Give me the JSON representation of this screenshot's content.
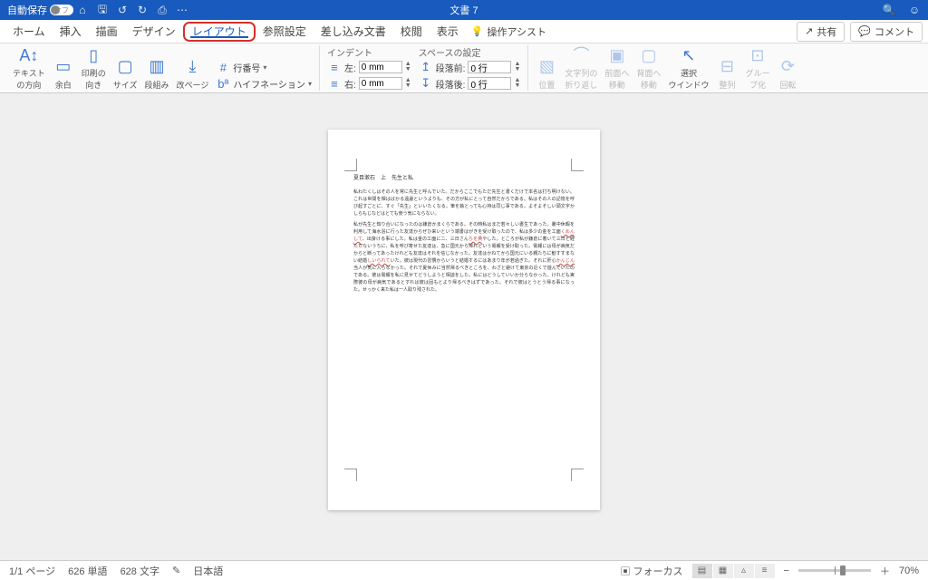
{
  "titlebar": {
    "autosave_label": "自動保存",
    "autosave_state": "オフ",
    "doc_title": "文書 7"
  },
  "tabs": {
    "items": [
      {
        "label": "ホーム",
        "active": false
      },
      {
        "label": "挿入",
        "active": false
      },
      {
        "label": "描画",
        "active": false
      },
      {
        "label": "デザイン",
        "active": false
      },
      {
        "label": "レイアウト",
        "active": true,
        "highlight": true
      },
      {
        "label": "参照設定",
        "active": false
      },
      {
        "label": "差し込み文書",
        "active": false
      },
      {
        "label": "校閲",
        "active": false
      },
      {
        "label": "表示",
        "active": false
      }
    ],
    "tell_me": "操作アシスト",
    "share": "共有",
    "comment": "コメント"
  },
  "ribbon": {
    "page_setup": {
      "text_dir": "テキスト\nの方向",
      "margins": "余白",
      "orientation": "印刷の\n向き",
      "size": "サイズ",
      "columns": "段組み",
      "breaks": "改ページ",
      "line_numbers": "行番号",
      "hyphenation": "ハイフネーション"
    },
    "indent": {
      "header": "インデント",
      "left_label": "左:",
      "left_value": "0 mm",
      "right_label": "右:",
      "right_value": "0 mm"
    },
    "spacing": {
      "header": "スペースの設定",
      "before_label": "段落前:",
      "before_value": "0 行",
      "after_label": "段落後:",
      "after_value": "0 行"
    },
    "arrange": {
      "position": "位置",
      "wrap": "文字列の\n折り返し",
      "forward": "前面へ\n移動",
      "backward": "背面へ\n移動",
      "selection": "選択\nウインドウ",
      "align": "整列",
      "group": "グルー\nプ化",
      "rotate": "回転"
    }
  },
  "document": {
    "heading": "夏目漱石　上　先生と私",
    "p1": "私わたくしはその人を常に先生と呼んでいた。だからここでもただ先生と書くだけで本名は打ち明けない。これは世間を憚はばかる遠慮というよりも、その方が私にとって自然だからである。私はその人の記憶を呼び起すごとに、すぐ「先生」といいたくなる。筆を執とっても心持は同じ事である。よそよそしい頭文字かしらもじなどはとても使う気にならない。",
    "p2_a": "私が先生と知り合いになったのは鎌倉かまくらである。その時私はまだ若々しい書生であった。暑中休暇を利用して海水浴に行った友達からぜひ来いという端書はがきを受け取ったので、私は多少の金を工面",
    "p2_r1": "くめんして",
    "p2_b": "、出掛ける事にした。私は金の工面に二、三日さん",
    "p2_r2": "ちを費",
    "p2_c": "やした。ところが私が鎌倉に着いて三日と経たたないうちに、私を呼び寄せた友達は、急に国元から帰れという電報を受け取った。電報には母が病気だからと断ってあったけれども友達はそれを信じなかった。友達はかねてから国元にいる親たちに勧すすまない結婚",
    "p2_r3": "しいられて",
    "p2_d": "いた。彼は現代の習慣からいうと結婚するにはあまり年が若過ぎた。それに肝心",
    "p2_r4": "かんじん",
    "p2_e": "当人が気に入らなかった。それで夏休みに当然帰るべきところを、わざと避けて東京の近くで遊んでいたのである。彼は電報を私に見せてどうしようと相談をした。私にはどうしていいか分らなかった。けれども実際彼の母が病気であるとすれば彼は固もとより帰るべきはずであった。それで彼はとうとう帰る事になった。せっかく来た私は一人取り残された。"
  },
  "statusbar": {
    "page": "1/1 ページ",
    "words": "626 単語",
    "chars": "628 文字",
    "lang": "日本語",
    "focus": "フォーカス",
    "zoom": "70%"
  }
}
